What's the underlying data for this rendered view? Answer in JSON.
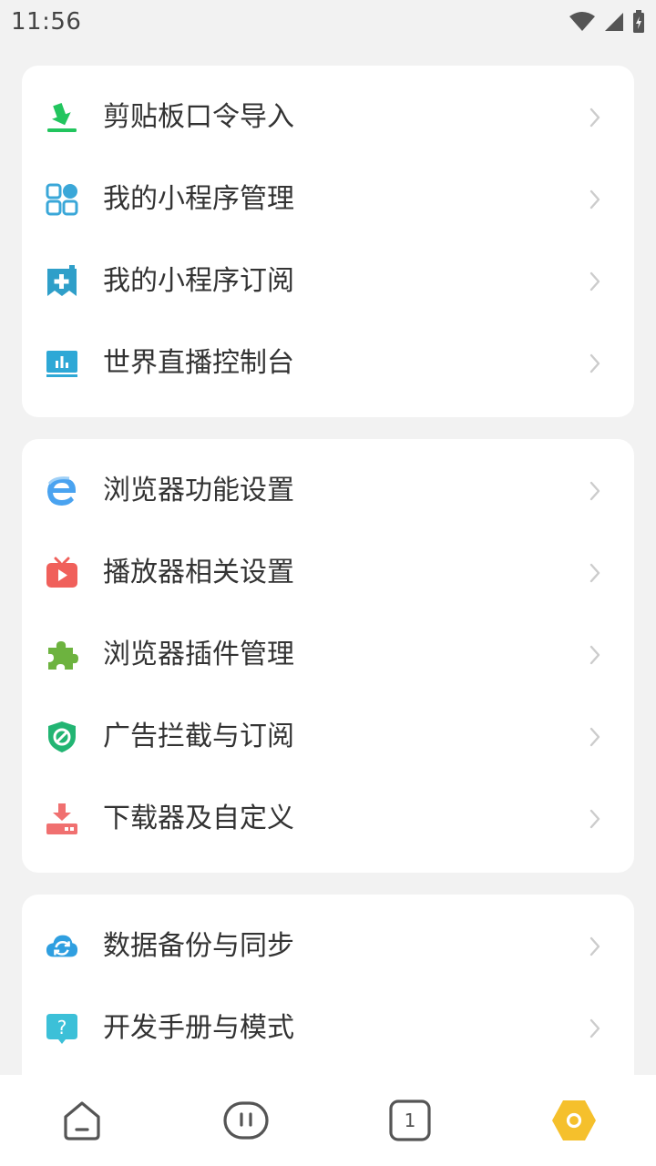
{
  "status_bar": {
    "time": "11:56"
  },
  "sections": [
    {
      "items": [
        {
          "label": "剪贴板口令导入",
          "icon": "import-download-icon",
          "color": "#22c55e"
        },
        {
          "label": "我的小程序管理",
          "icon": "grid-apps-icon",
          "color": "#3aa7d8"
        },
        {
          "label": "我的小程序订阅",
          "icon": "bookmark-plus-icon",
          "color": "#2f9fc9"
        },
        {
          "label": "世界直播控制台",
          "icon": "monitor-chart-icon",
          "color": "#2ea8d6"
        }
      ]
    },
    {
      "items": [
        {
          "label": "浏览器功能设置",
          "icon": "browser-e-icon",
          "color": "#4aa3f0"
        },
        {
          "label": "播放器相关设置",
          "icon": "tv-play-icon",
          "color": "#f0605b"
        },
        {
          "label": "浏览器插件管理",
          "icon": "puzzle-piece-icon",
          "color": "#6db33f"
        },
        {
          "label": "广告拦截与订阅",
          "icon": "shield-block-icon",
          "color": "#22b573"
        },
        {
          "label": "下载器及自定义",
          "icon": "download-tray-icon",
          "color": "#f07070"
        }
      ]
    },
    {
      "items": [
        {
          "label": "数据备份与同步",
          "icon": "cloud-sync-icon",
          "color": "#2f9fe0"
        },
        {
          "label": "开发手册与模式",
          "icon": "help-question-icon",
          "color": "#3cc0d8"
        }
      ]
    }
  ],
  "bottom_nav": {
    "tab_count": "1",
    "accent": "#f5c02c"
  }
}
